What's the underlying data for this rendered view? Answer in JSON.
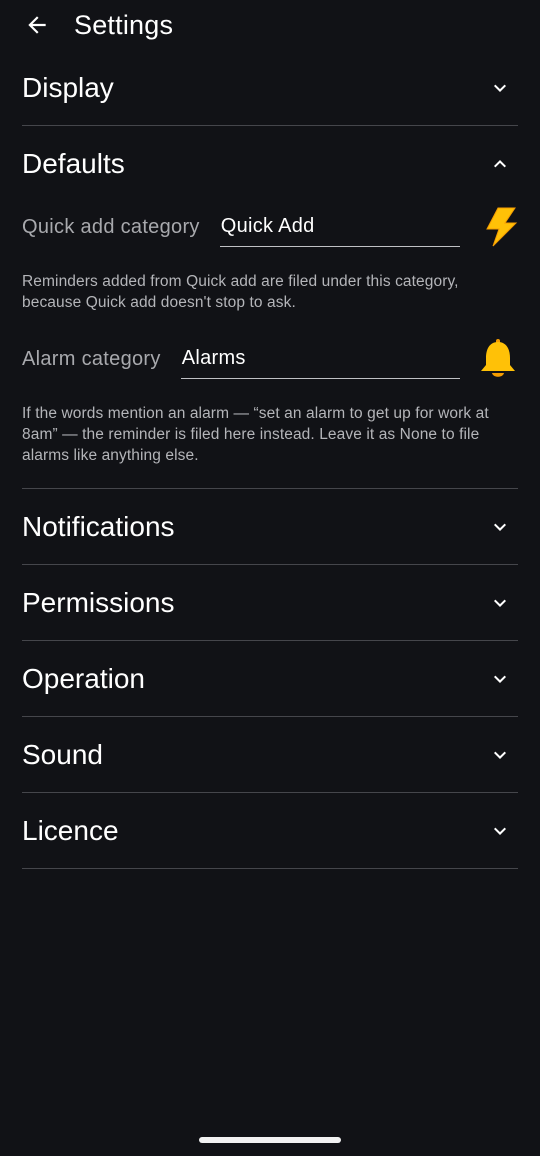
{
  "header": {
    "title": "Settings",
    "back_icon": "arrow-left-icon"
  },
  "sections": {
    "display": {
      "title": "Display",
      "expanded": false
    },
    "defaults": {
      "title": "Defaults",
      "expanded": true,
      "quick_add": {
        "label": "Quick add category",
        "value": "Quick Add",
        "icon": "lightning-bolt-icon",
        "help": "Reminders added from Quick add are filed under this category, because Quick add doesn't stop to ask."
      },
      "alarm": {
        "label": "Alarm category",
        "value": "Alarms",
        "icon": "bell-icon",
        "help": "If the words mention an alarm — “set an alarm to get up for work at 8am” — the reminder is filed here instead. Leave it as None to file alarms like anything else."
      }
    },
    "notifications": {
      "title": "Notifications",
      "expanded": false
    },
    "permissions": {
      "title": "Permissions",
      "expanded": false
    },
    "operation": {
      "title": "Operation",
      "expanded": false
    },
    "sound": {
      "title": "Sound",
      "expanded": false
    },
    "licence": {
      "title": "Licence",
      "expanded": false
    }
  },
  "colors": {
    "background": "#111216",
    "divider": "#45464b",
    "accent": "#ffc107"
  }
}
